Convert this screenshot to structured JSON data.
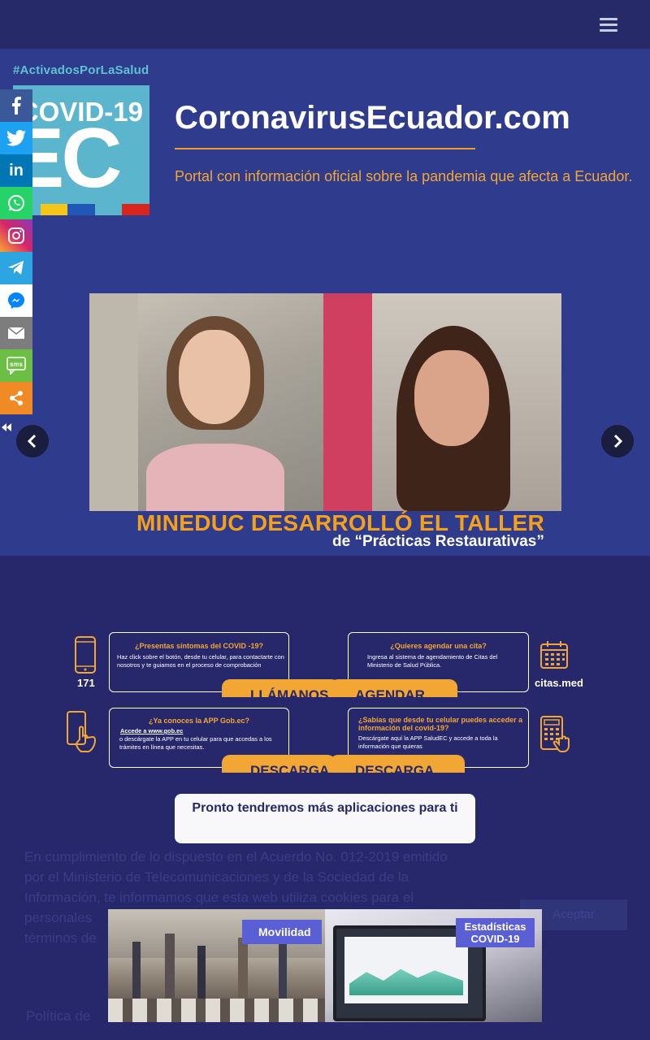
{
  "header": {
    "menu_icon": "hamburger-menu-icon"
  },
  "hero": {
    "hashtag": "#ActivadosPorLaSalud",
    "logo": {
      "top_text": "COVID-19",
      "big_text": "EC",
      "stripe_colors": [
        "#f5c518",
        "#1f58b6",
        "#d8261f"
      ]
    },
    "site_title": "CoronavirusEcuador.com",
    "tagline": "Portal con información oficial sobre la pandemia que afecta a Ecuador."
  },
  "social": {
    "items": [
      {
        "icon": "facebook-icon",
        "glyph": "f",
        "color": "#3b5998"
      },
      {
        "icon": "twitter-icon",
        "glyph": "🐦",
        "color": "#1da1f2"
      },
      {
        "icon": "linkedin-icon",
        "glyph": "in",
        "color": "#0077b5"
      },
      {
        "icon": "whatsapp-icon",
        "glyph": "✆",
        "color": "#25d366"
      },
      {
        "icon": "instagram-icon",
        "glyph": "◎",
        "color": "#c13584"
      },
      {
        "icon": "telegram-icon",
        "glyph": "➤",
        "color": "#2ca5e0"
      },
      {
        "icon": "messenger-icon",
        "glyph": "⚡",
        "color": "#ffffff"
      },
      {
        "icon": "email-icon",
        "glyph": "✉",
        "color": "#7d7d7d"
      },
      {
        "icon": "sms-icon",
        "glyph": "sms",
        "color": "#6cbe45"
      },
      {
        "icon": "share-icon",
        "glyph": "<",
        "color": "#f08a24"
      }
    ],
    "hide_label": "«"
  },
  "slider": {
    "title": "MINEDUC DESARROLLÓ EL TALLER",
    "subtitle": "de “Prácticas Restaurativas”"
  },
  "apps": {
    "cards": [
      {
        "title": "¿Presentas síntomas del COVID -19?",
        "body": "Haz click sobre el botón, desde tu celular, para contactarte con nosotros y te guiamos en el proceso de comprobación"
      },
      {
        "title": "¿Quieres agendar una cita?",
        "body": "Ingresa al sistema de agendamiento de Citas del Ministerio de Salud Pública."
      },
      {
        "title": "¿Ya conoces la APP Gob.ec?",
        "link": "Accede a www.gob.ec",
        "body": "o descárgate la APP en tu celular para que accedas a los trámites en línea que necesitas."
      },
      {
        "title": "¿Sabías que desde tu celular puedes acceder a información del covid-19?",
        "body": "Descárgate aquí la APP SaludEC y accede a toda la información que quieras"
      }
    ],
    "buttons": [
      "LLÁMANOS",
      "AGENDAR",
      "DESCARGA",
      "DESCARGA"
    ],
    "icon_labels": [
      "171",
      "citas.med"
    ],
    "pronto": "Pronto tendremos más aplicaciones para ti"
  },
  "banner": {
    "left_badge": "Movilidad",
    "right_badge_line1": "Estadísticas",
    "right_badge_line2": "COVID-19"
  },
  "background_text": {
    "lines": [
      "En cumplimiento de lo dispuesto en el Acuerdo No. 012-2019 emitido",
      "por el Ministerio de Telecomunicaciones y de la Sociedad de la",
      "Información, te informamos que esta web utiliza cookies para el",
      "personales",
      "términos de"
    ],
    "button": "Aceptar",
    "footer": "Política de"
  }
}
